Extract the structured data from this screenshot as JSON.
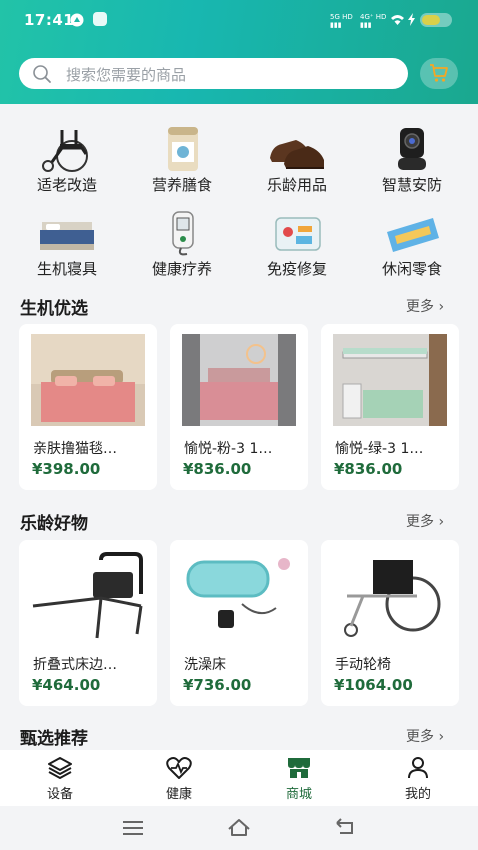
{
  "status": {
    "time": "17:41"
  },
  "search": {
    "placeholder": "搜索您需要的商品"
  },
  "categories": [
    {
      "label": "适老改造",
      "icon": "wheelchair-icon"
    },
    {
      "label": "营养膳食",
      "icon": "milk-powder-can-icon"
    },
    {
      "label": "乐龄用品",
      "icon": "leather-shoes-icon"
    },
    {
      "label": "智慧安防",
      "icon": "smart-camera-icon"
    },
    {
      "label": "生机寝具",
      "icon": "bed-icon"
    },
    {
      "label": "健康疗养",
      "icon": "glucose-meter-icon"
    },
    {
      "label": "免疫修复",
      "icon": "medicine-kit-icon"
    },
    {
      "label": "休闲零食",
      "icon": "snack-pack-icon"
    }
  ],
  "sections": [
    {
      "title": "生机优选",
      "more": "更多",
      "items": [
        {
          "name": "亲肤撸猫毯…",
          "price": "¥398.00",
          "icon": "pink-bed-photo"
        },
        {
          "name": "愉悦-粉-3 1…",
          "price": "¥836.00",
          "icon": "pink-bedroom-photo"
        },
        {
          "name": "愉悦-绿-3 1…",
          "price": "¥836.00",
          "icon": "green-bunkbed-photo"
        }
      ]
    },
    {
      "title": "乐龄好物",
      "more": "更多",
      "items": [
        {
          "name": "折叠式床边…",
          "price": "¥464.00",
          "icon": "bed-rail-photo"
        },
        {
          "name": "洗澡床",
          "price": "¥736.00",
          "icon": "inflatable-bath-photo"
        },
        {
          "name": "手动轮椅",
          "price": "¥1064.00",
          "icon": "wheelchair-photo"
        }
      ]
    },
    {
      "title": "甄选推荐",
      "more": "更多",
      "items": []
    }
  ],
  "tabbar": [
    {
      "label": "设备",
      "icon": "layers-icon"
    },
    {
      "label": "健康",
      "icon": "heart-pulse-icon"
    },
    {
      "label": "商城",
      "icon": "store-icon",
      "active": true
    },
    {
      "label": "我的",
      "icon": "user-icon"
    }
  ],
  "colors": {
    "accent": "#1f6b3b",
    "header_start": "#22c3a8",
    "cart_orange": "#f5a623"
  }
}
